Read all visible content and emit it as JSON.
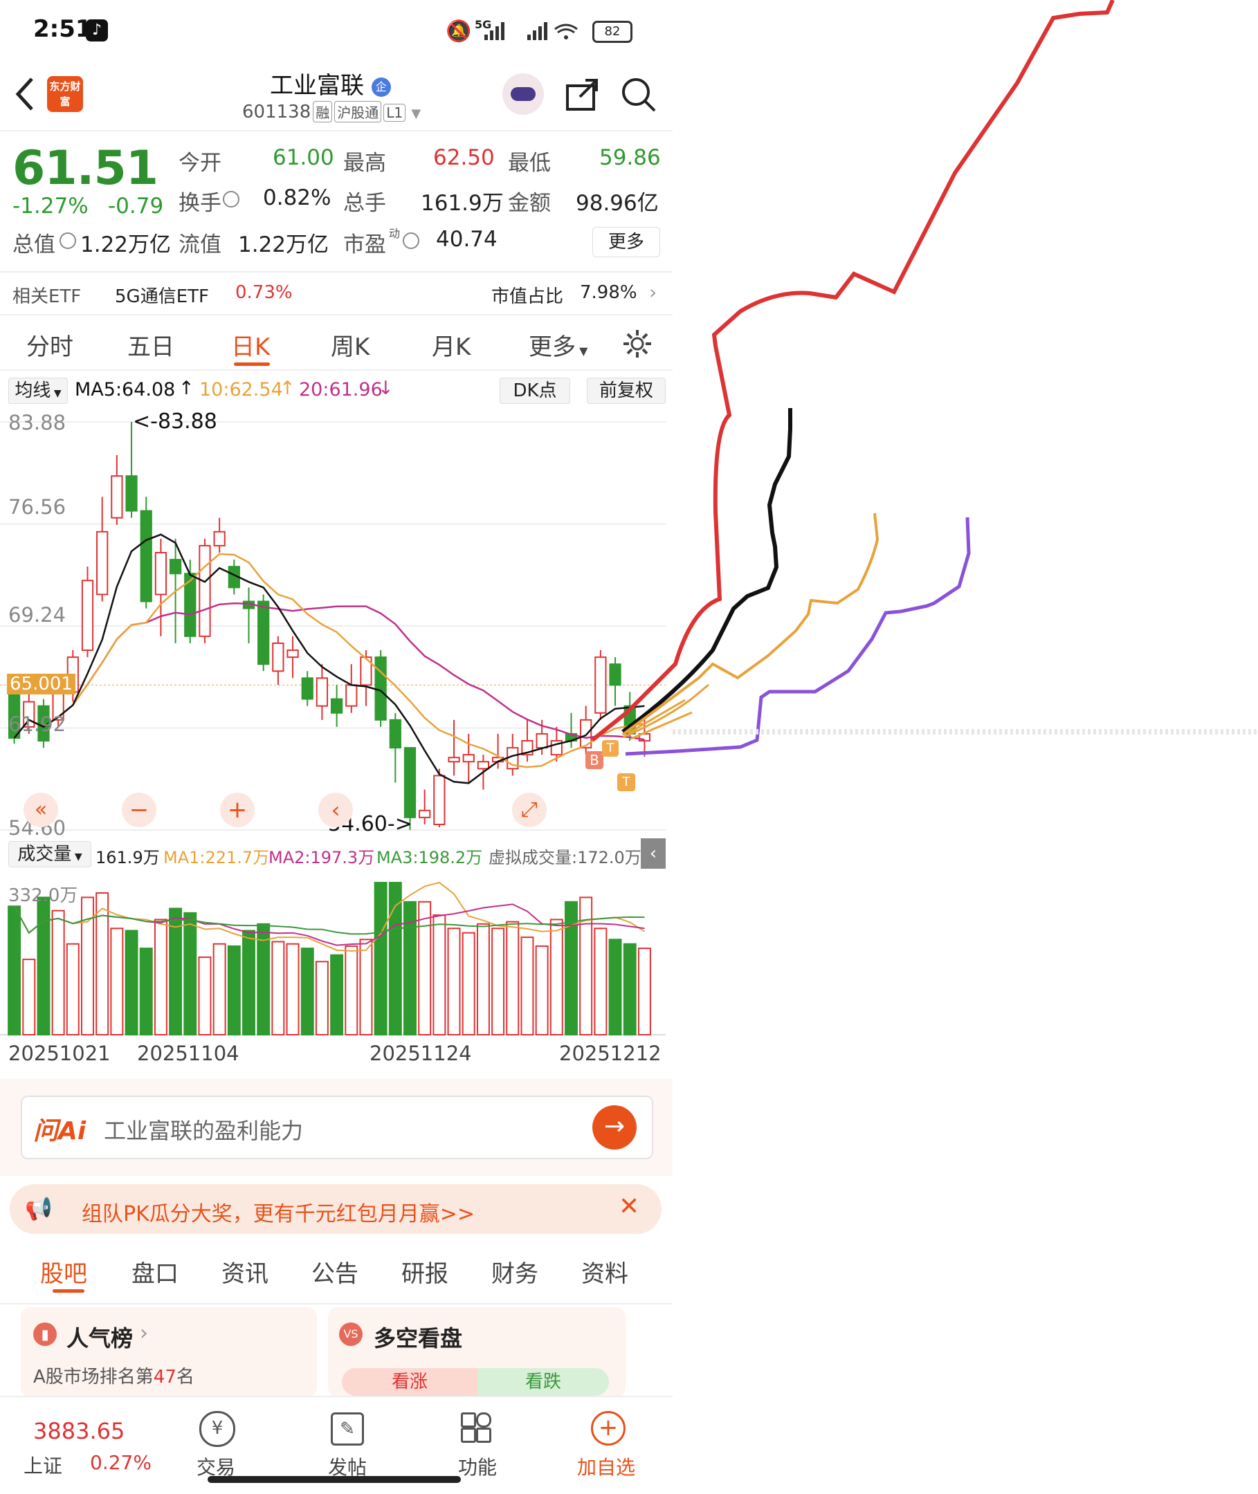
{
  "status_bar": {
    "time": "2:51",
    "network": "5G",
    "battery": "82"
  },
  "header": {
    "title": "工业富联",
    "code": "601138",
    "tags": [
      "融",
      "沪股通",
      "L1"
    ],
    "logo_text": "东方财富"
  },
  "quote": {
    "price": "61.51",
    "change_pct": "-1.27%",
    "change": "-0.79",
    "open_label": "今开",
    "open": "61.00",
    "high_label": "最高",
    "high": "62.50",
    "low_label": "最低",
    "low": "59.86",
    "turnover_label": "换手",
    "turnover": "0.82%",
    "volume_label": "总手",
    "volume": "161.9万",
    "amount_label": "金额",
    "amount": "98.96亿",
    "mktcap_label": "总值",
    "mktcap": "1.22万亿",
    "float_label": "流值",
    "float": "1.22万亿",
    "pe_label": "市盈",
    "pe_sup": "动",
    "pe": "40.74",
    "more": "更多"
  },
  "etf": {
    "label": "相关ETF",
    "name": "5G通信ETF",
    "pct": "0.73%",
    "share_label": "市值占比",
    "share": "7.98%"
  },
  "tabs": [
    "分时",
    "五日",
    "日K",
    "周K",
    "月K",
    "更多"
  ],
  "active_tab": "日K",
  "ma_row": {
    "selector": "均线",
    "ma5": "MA5:64.08",
    "ma10": "10:62.54",
    "ma20": "20:61.96",
    "dk": "DK点",
    "adjust": "前复权"
  },
  "kline": {
    "y_labels": [
      "83.88",
      "76.56",
      "69.24",
      "61.92",
      "54.60"
    ],
    "max_note": "<-83.88",
    "min_note": "54.60->",
    "current_line": "65.001",
    "markers": [
      "B",
      "T",
      "T"
    ]
  },
  "volume_row": {
    "selector": "成交量",
    "vol": "161.9万",
    "ma1": "MA1:221.7万",
    "ma2": "MA2:197.3万",
    "ma3": "MA3:198.2万",
    "virtual": "虚拟成交量:172.0万",
    "y_label": "332.0万"
  },
  "x_dates": [
    "20251021",
    "20251104",
    "20251124",
    "20251212"
  ],
  "ask_ai": {
    "brand": "问Ai",
    "placeholder": "工业富联的盈利能力"
  },
  "promo": {
    "text": "组队PK瓜分大奖，更有千元红包月月赢>>"
  },
  "bottom_tabs": [
    "股吧",
    "盘口",
    "资讯",
    "公告",
    "研报",
    "财务",
    "资料"
  ],
  "cards": {
    "popular": "人气榜",
    "rank": "A股市场排名第",
    "rank_num": "47",
    "rank_suffix": "名",
    "bull_bear": "多空看盘",
    "up": "看涨",
    "down": "看跌"
  },
  "footer": {
    "index_value": "3883.65",
    "index_name": "上证",
    "index_pct": "0.27%",
    "items": [
      "交易",
      "发帖",
      "功能",
      "加自选"
    ]
  },
  "chart_data": {
    "type": "candlestick",
    "ylim": [
      54.6,
      83.88
    ],
    "ma_colors": {
      "ma5": "#111111",
      "ma10": "#e8a23a",
      "ma20": "#c0308a"
    },
    "candles": [
      {
        "o": 64.5,
        "c": 61.2,
        "h": 65.0,
        "l": 60.8
      },
      {
        "o": 62.0,
        "c": 63.8,
        "h": 64.5,
        "l": 61.5
      },
      {
        "o": 63.5,
        "c": 61.0,
        "h": 64.0,
        "l": 60.5
      },
      {
        "o": 62.5,
        "c": 64.8,
        "h": 65.5,
        "l": 62.0
      },
      {
        "o": 64.5,
        "c": 67.0,
        "h": 67.5,
        "l": 63.8
      },
      {
        "o": 67.5,
        "c": 72.5,
        "h": 73.5,
        "l": 67.0
      },
      {
        "o": 71.5,
        "c": 76.0,
        "h": 78.5,
        "l": 71.0
      },
      {
        "o": 77.0,
        "c": 80.0,
        "h": 81.5,
        "l": 76.5
      },
      {
        "o": 80.0,
        "c": 77.5,
        "h": 83.88,
        "l": 77.0
      },
      {
        "o": 77.5,
        "c": 71.0,
        "h": 78.5,
        "l": 70.5
      },
      {
        "o": 71.5,
        "c": 74.5,
        "h": 75.5,
        "l": 68.5
      },
      {
        "o": 74.0,
        "c": 73.0,
        "h": 75.5,
        "l": 68.0
      },
      {
        "o": 73.0,
        "c": 68.5,
        "h": 74.0,
        "l": 68.0
      },
      {
        "o": 68.5,
        "c": 75.0,
        "h": 75.5,
        "l": 68.0
      },
      {
        "o": 75.0,
        "c": 76.0,
        "h": 77.0,
        "l": 74.5
      },
      {
        "o": 73.5,
        "c": 72.0,
        "h": 74.0,
        "l": 71.5
      },
      {
        "o": 71.0,
        "c": 70.5,
        "h": 72.0,
        "l": 68.0
      },
      {
        "o": 71.0,
        "c": 66.5,
        "h": 71.5,
        "l": 66.0
      },
      {
        "o": 66.0,
        "c": 68.0,
        "h": 68.5,
        "l": 65.0
      },
      {
        "o": 67.0,
        "c": 67.5,
        "h": 68.5,
        "l": 65.5
      },
      {
        "o": 65.5,
        "c": 64.0,
        "h": 66.0,
        "l": 63.5
      },
      {
        "o": 63.5,
        "c": 65.5,
        "h": 66.5,
        "l": 62.5
      },
      {
        "o": 64.0,
        "c": 63.0,
        "h": 65.0,
        "l": 62.0
      },
      {
        "o": 63.5,
        "c": 65.0,
        "h": 66.5,
        "l": 63.0
      },
      {
        "o": 65.0,
        "c": 67.0,
        "h": 67.5,
        "l": 63.5
      },
      {
        "o": 67.0,
        "c": 62.5,
        "h": 67.5,
        "l": 62.0
      },
      {
        "o": 62.5,
        "c": 60.5,
        "h": 63.0,
        "l": 58.0
      },
      {
        "o": 60.5,
        "c": 55.5,
        "h": 60.5,
        "l": 54.6
      },
      {
        "o": 55.5,
        "c": 56.0,
        "h": 57.5,
        "l": 55.0
      },
      {
        "o": 55.0,
        "c": 58.5,
        "h": 59.0,
        "l": 54.8
      },
      {
        "o": 59.5,
        "c": 59.8,
        "h": 62.5,
        "l": 58.5
      },
      {
        "o": 59.5,
        "c": 60.0,
        "h": 61.5,
        "l": 58.0
      },
      {
        "o": 59.0,
        "c": 59.5,
        "h": 60.0,
        "l": 57.5
      },
      {
        "o": 59.5,
        "c": 59.8,
        "h": 61.5,
        "l": 59.0
      },
      {
        "o": 59.0,
        "c": 60.5,
        "h": 61.5,
        "l": 58.5
      },
      {
        "o": 60.0,
        "c": 61.0,
        "h": 62.5,
        "l": 59.5
      },
      {
        "o": 60.5,
        "c": 61.5,
        "h": 62.5,
        "l": 60.0
      },
      {
        "o": 60.0,
        "c": 61.0,
        "h": 62.0,
        "l": 59.5
      },
      {
        "o": 61.5,
        "c": 61.0,
        "h": 63.0,
        "l": 60.5
      },
      {
        "o": 60.5,
        "c": 62.5,
        "h": 63.5,
        "l": 60.0
      },
      {
        "o": 63.0,
        "c": 67.0,
        "h": 67.5,
        "l": 62.5
      },
      {
        "o": 66.5,
        "c": 65.0,
        "h": 67.0,
        "l": 63.5
      },
      {
        "o": 63.5,
        "c": 61.5,
        "h": 64.5,
        "l": 61.0
      },
      {
        "o": 61.0,
        "c": 61.5,
        "h": 62.5,
        "l": 59.86
      }
    ],
    "volumes": [
      290,
      170,
      310,
      280,
      205,
      310,
      320,
      240,
      235,
      195,
      260,
      285,
      275,
      175,
      205,
      200,
      235,
      250,
      210,
      205,
      195,
      165,
      180,
      200,
      215,
      380,
      480,
      300,
      300,
      270,
      240,
      230,
      250,
      240,
      255,
      220,
      200,
      260,
      300,
      310,
      240,
      215,
      205,
      195
    ]
  }
}
